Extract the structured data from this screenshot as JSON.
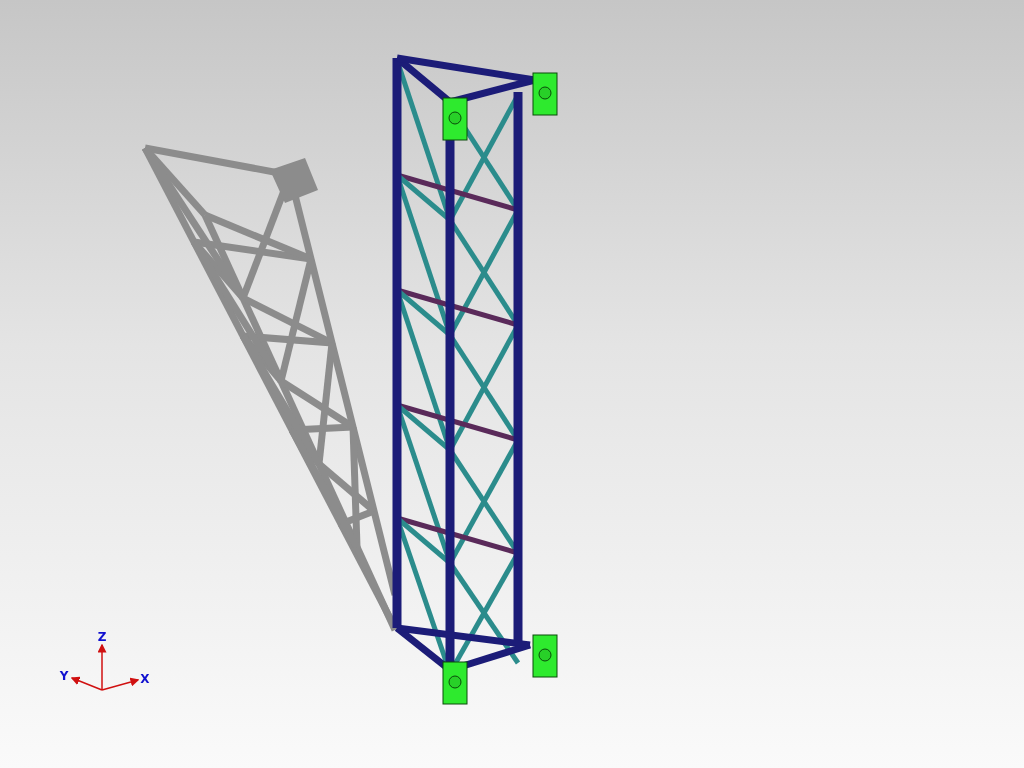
{
  "viewport": {
    "triad": {
      "axes": [
        {
          "kind": "z",
          "label": "Z"
        },
        {
          "kind": "y",
          "label": "Y"
        },
        {
          "kind": "x",
          "label": "X"
        }
      ]
    }
  }
}
